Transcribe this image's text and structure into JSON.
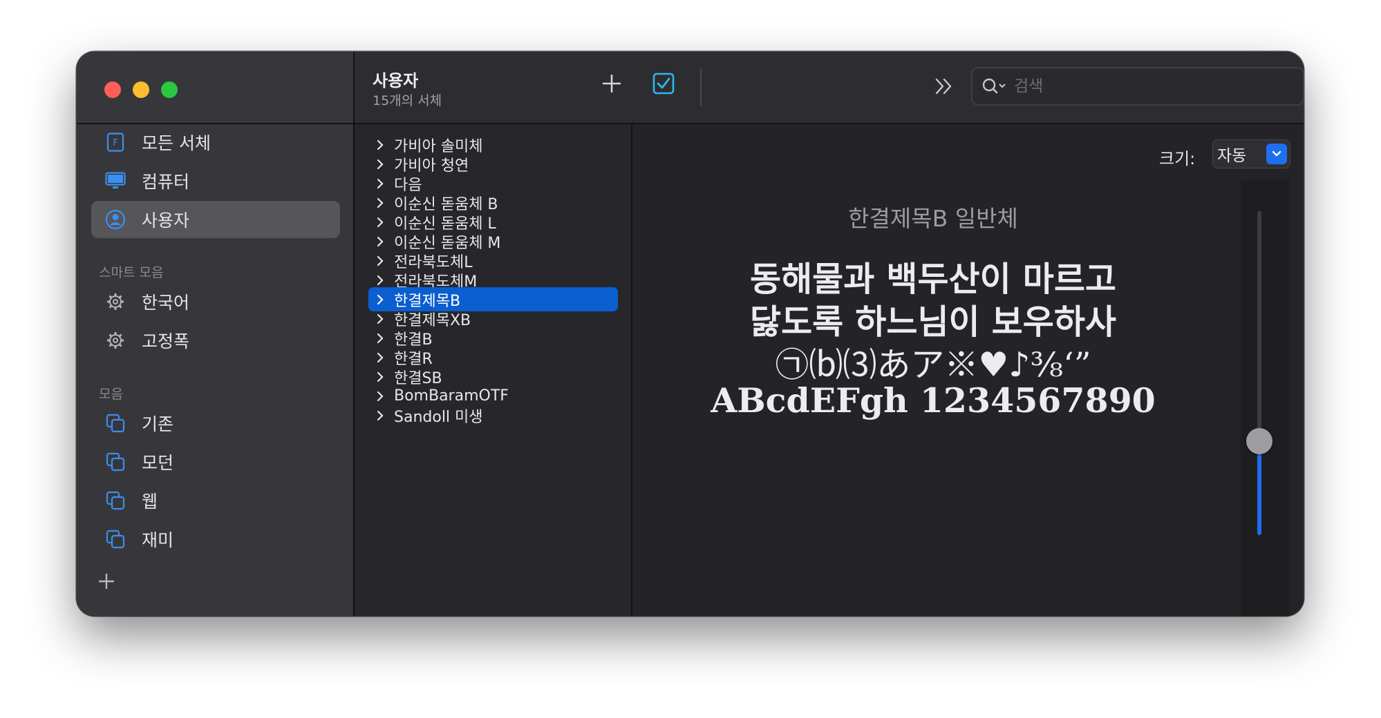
{
  "toolbar": {
    "title": "사용자",
    "subtitle": "15개의 서체",
    "search_placeholder": "검색"
  },
  "sidebar": {
    "items": [
      {
        "label": "모든 서체",
        "icon": "font-file-icon",
        "selected": false
      },
      {
        "label": "컴퓨터",
        "icon": "computer-icon",
        "selected": false
      },
      {
        "label": "사용자",
        "icon": "user-icon",
        "selected": true
      }
    ],
    "smart_section": "스마트 모음",
    "smart_items": [
      {
        "label": "한국어",
        "icon": "gear-icon"
      },
      {
        "label": "고정폭",
        "icon": "gear-icon"
      }
    ],
    "collection_section": "모음",
    "collections": [
      {
        "label": "기존",
        "icon": "collection-icon"
      },
      {
        "label": "모던",
        "icon": "collection-icon"
      },
      {
        "label": "웹",
        "icon": "collection-icon"
      },
      {
        "label": "재미",
        "icon": "collection-icon"
      }
    ]
  },
  "font_list": [
    "가비아 솔미체",
    "가비아 청연",
    "다음",
    "이순신 돋움체 B",
    "이순신 돋움체 L",
    "이순신 돋움체 M",
    "전라북도체L",
    "전라북도체M",
    "한결제목B",
    "한결제목XB",
    "한결B",
    "한결R",
    "한결SB",
    "BomBaramOTF",
    "Sandoll 미생"
  ],
  "selected_font_index": 8,
  "preview": {
    "size_label": "크기:",
    "size_value": "자동",
    "font_name": "한결제목B 일반체",
    "lines": [
      "동해물과 백두산이 마르고",
      "닳도록 하느님이 보우하사",
      "㉠⒝⑶あア※♥♪⅜‘”",
      "ABcdEFgh 1234567890"
    ],
    "slider_level": 0.3
  },
  "colors": {
    "accent": "#0a5ecf",
    "close": "#ff5f57",
    "minimize": "#febc2e",
    "maximize": "#28c840"
  }
}
